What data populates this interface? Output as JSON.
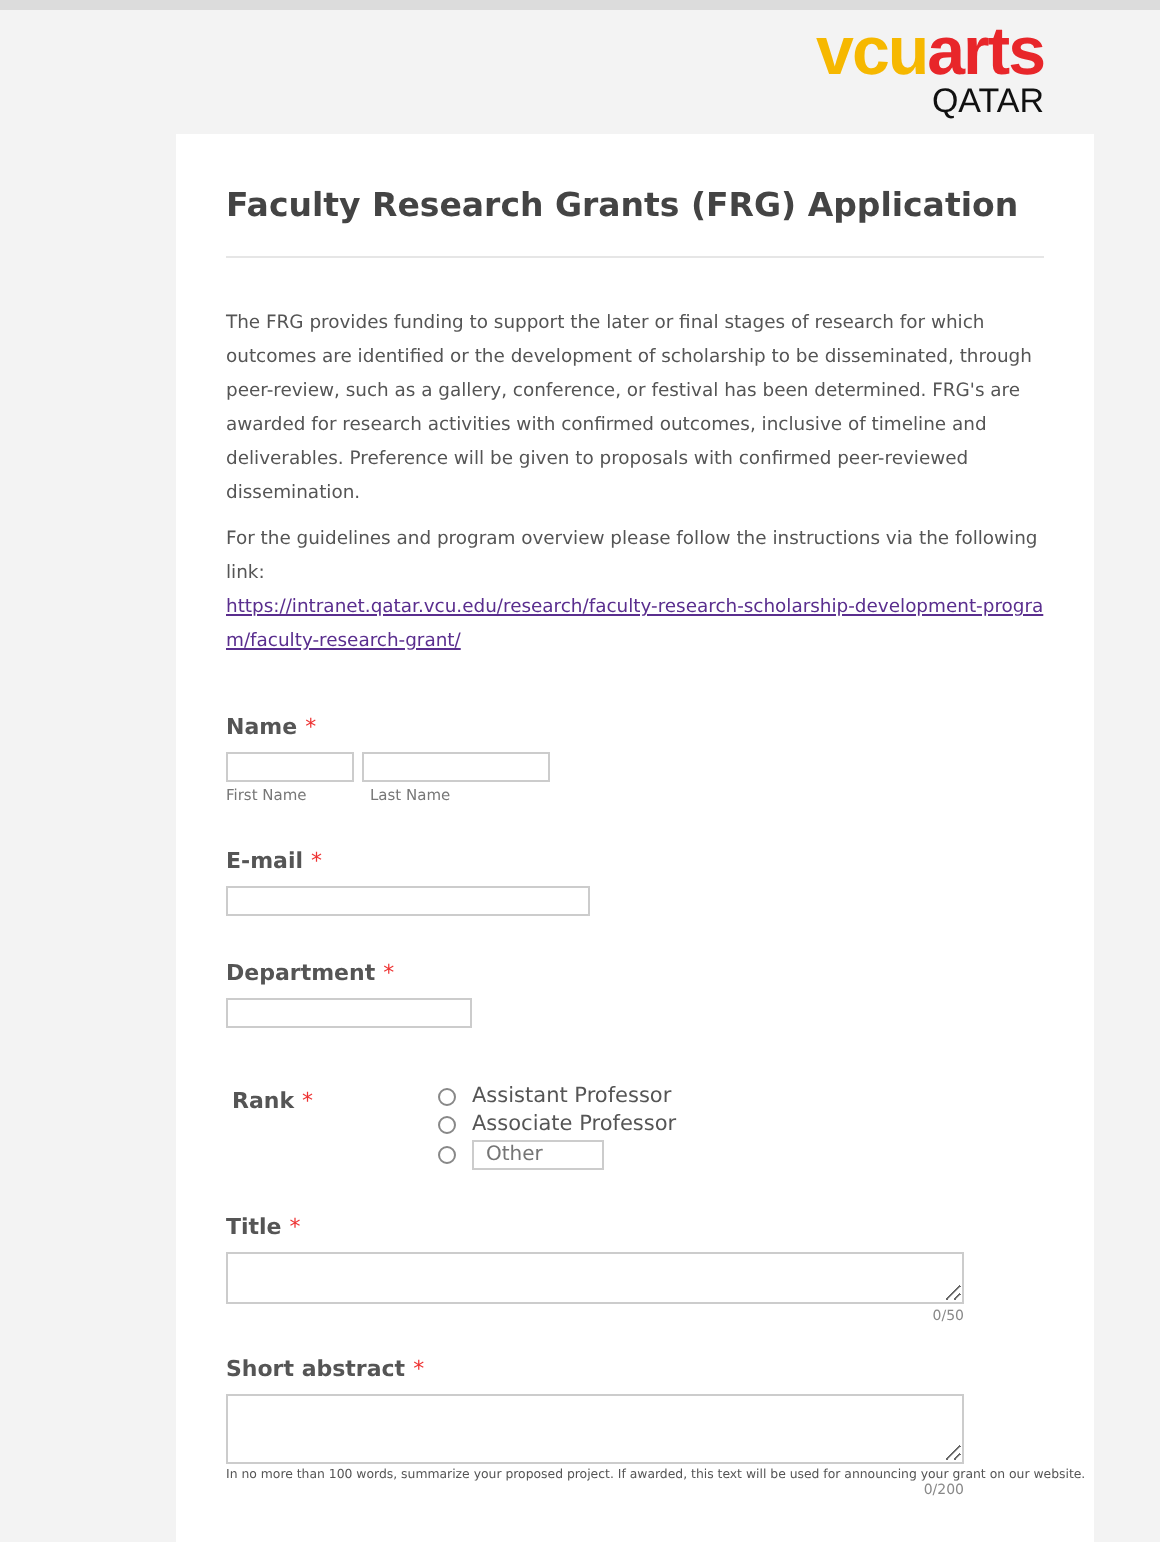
{
  "logo": {
    "part_1": "vcu",
    "part_2": "arts",
    "subtitle": "QATAR"
  },
  "form": {
    "title": "Faculty Research Grants (FRG) Application",
    "intro": "The FRG provides funding to support the later or final stages of research for which outcomes are identified or the development of scholarship to be disseminated, through peer-review, such as a gallery, conference, or festival has been determined. FRG's are awarded for research activities with confirmed outcomes, inclusive of timeline and deliverables. Preference will be given to proposals with confirmed peer-reviewed dissemination.",
    "guidelines": "For the guidelines and program overview please follow the instructions via the following link:",
    "link": "https://intranet.qatar.vcu.edu/research/faculty-research-scholarship-development-program/faculty-research-grant/",
    "required_mark": "*",
    "name": {
      "label": "Name",
      "first": "First Name",
      "last": "Last Name"
    },
    "email": {
      "label": "E-mail"
    },
    "department": {
      "label": "Department"
    },
    "rank": {
      "label": "Rank",
      "options": [
        {
          "label": "Assistant Professor",
          "selected": false
        },
        {
          "label": "Associate Professor",
          "selected": false
        }
      ],
      "other": {
        "placeholder": "Other",
        "selected": false
      }
    },
    "title_field": {
      "label": "Title",
      "counter": "0/50"
    },
    "abstract": {
      "label": "Short abstract",
      "help": "In no more than 100 words, summarize your proposed project. If awarded, this text will be used for announcing your grant on our website.",
      "counter": "0/200"
    }
  }
}
